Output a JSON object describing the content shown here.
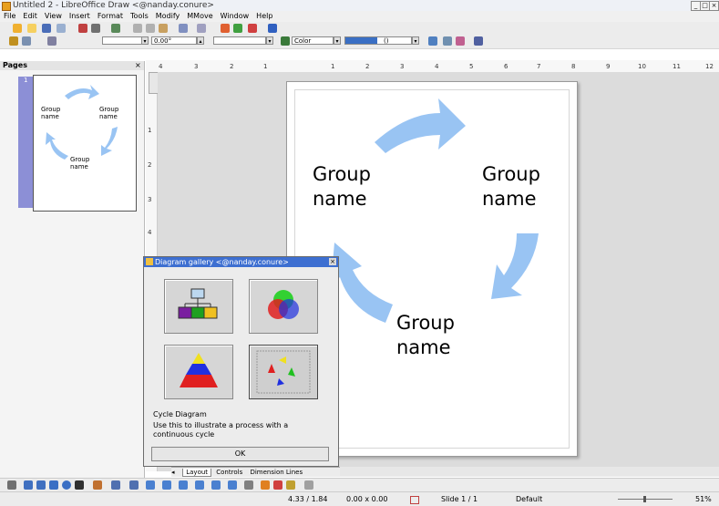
{
  "window": {
    "title": "Untitled 2 - LibreOffice Draw <@nanday.conure>",
    "buttons": [
      "_",
      "□",
      "×"
    ]
  },
  "menu": [
    "File",
    "Edit",
    "View",
    "Insert",
    "Format",
    "Tools",
    "Modify",
    "MMove",
    "Window",
    "Help"
  ],
  "line_toolbar": {
    "angle_value": "0.00°",
    "fill_type": "Color",
    "area_label": "()"
  },
  "pages_panel": {
    "title": "Pages",
    "close": "×",
    "page_number": "1"
  },
  "thumbnail": {
    "labels": [
      "Group\nname",
      "Group\nname",
      "Group\nname"
    ]
  },
  "ruler": {
    "h_ticks": [
      "4",
      "3",
      "2",
      "1",
      "1",
      "2",
      "3",
      "4",
      "5",
      "6",
      "7",
      "8",
      "9",
      "10",
      "11",
      "12"
    ],
    "v_ticks": [
      "1",
      "2",
      "3",
      "4"
    ]
  },
  "slide": {
    "labels": [
      "Group\nname",
      "Group\nname",
      "Group\nname"
    ],
    "arrow_color": "#99c4f3"
  },
  "dialog": {
    "title": "Diagram gallery <@nanday.conure>",
    "items": [
      "organization-chart",
      "venn-diagram",
      "pyramid-diagram",
      "cycle-diagram"
    ],
    "selected_name": "Cycle Diagram",
    "description": "Use this to illustrate a process with a continuous cycle",
    "ok": "OK"
  },
  "tabs": [
    "Layout",
    "Controls",
    "Dimension Lines"
  ],
  "status": {
    "position": "4.33 / 1.84",
    "size": "0.00 x 0.00",
    "slide": "Slide 1 / 1",
    "master": "Default",
    "zoom": "51%"
  }
}
